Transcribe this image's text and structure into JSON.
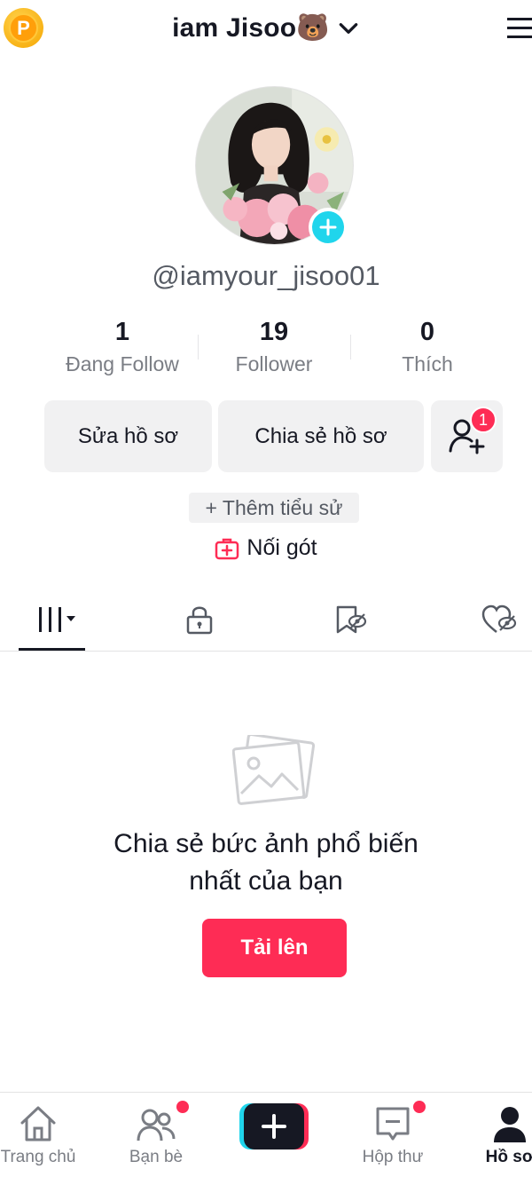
{
  "header": {
    "coin_letter": "P",
    "title": "iam Jisoo🐻"
  },
  "profile": {
    "handle": "@iamyour_jisoo01",
    "stats": [
      {
        "value": "1",
        "label": "Đang Follow"
      },
      {
        "value": "19",
        "label": "Follower"
      },
      {
        "value": "0",
        "label": "Thích"
      }
    ]
  },
  "actions": {
    "edit_profile": "Sửa hồ sơ",
    "share_profile": "Chia sẻ hồ sơ",
    "friend_badge": "1"
  },
  "bio": {
    "add_bio": "+ Thêm tiểu sử",
    "link_label": "Nối gót"
  },
  "tabs": [
    {
      "icon": "grid-icon",
      "active": true
    },
    {
      "icon": "lock-icon",
      "active": false
    },
    {
      "icon": "bookmark-hidden-icon",
      "active": false
    },
    {
      "icon": "heart-hidden-icon",
      "active": false
    }
  ],
  "empty_state": {
    "line1": "Chia sẻ bức ảnh phổ biến",
    "line2": "nhất của bạn",
    "upload_label": "Tải lên"
  },
  "bottom_nav": [
    {
      "label": "Trang chủ",
      "icon": "home-icon"
    },
    {
      "label": "Bạn bè",
      "icon": "friends-icon",
      "dot": true
    },
    {
      "label": "",
      "icon": "create-icon"
    },
    {
      "label": "Hộp thư",
      "icon": "inbox-icon",
      "dot": true
    },
    {
      "label": "Hồ sơ",
      "icon": "profile-icon",
      "active": true
    }
  ],
  "colors": {
    "accent": "#fe2c55",
    "cyan": "#20d5ec",
    "text": "#161823",
    "muted": "#7a7d84",
    "button_bg": "#f1f1f2"
  }
}
